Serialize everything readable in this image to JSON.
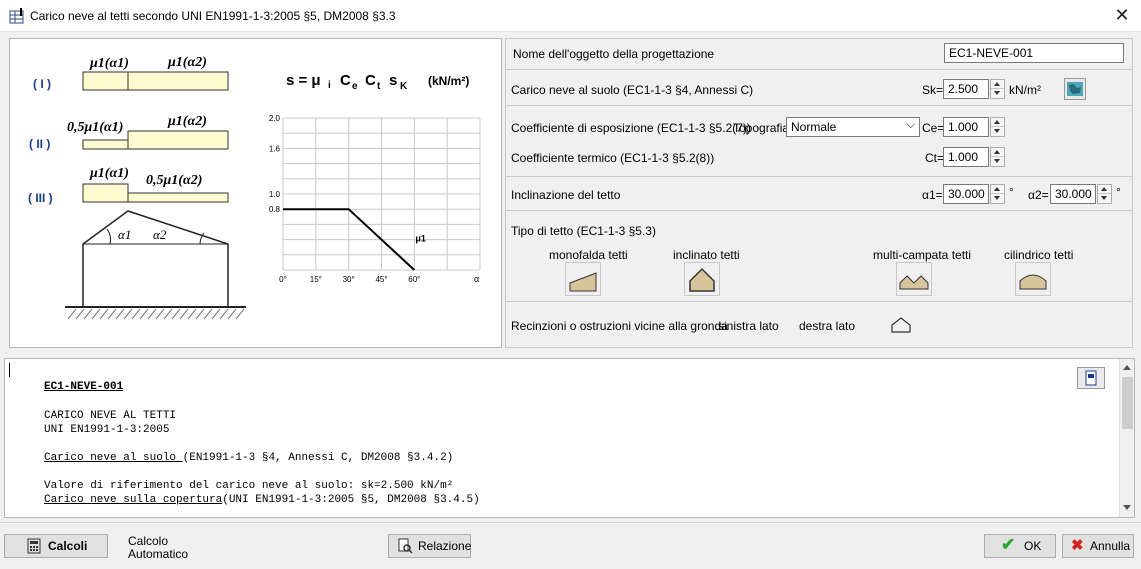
{
  "window": {
    "title": "Carico neve al tetti secondo UNI EN1991-1-3:2005 §5, DM2008 §3.3"
  },
  "diagram": {
    "formula_s": "s = μ",
    "formula_i": "i",
    "formula_ce": "C",
    "formula_ce_sub": "e",
    "formula_ct": "C",
    "formula_ct_sub": "t",
    "formula_sk": "s",
    "formula_sk_sub": "K",
    "formula_units": "(kN/m²)",
    "case_I": "( I )",
    "case_II": "( II )",
    "case_III": "( III )",
    "mu1a1": "μ1(α1)",
    "mu1a2": "μ1(α2)",
    "half_mu1a1": "0,5μ1(α1)",
    "half_mu1a2": "0,5μ1(α2)",
    "alpha1": "α1",
    "alpha2": "α2",
    "chart_mu_label": "μ1",
    "chart_alpha_label": "α"
  },
  "chart_data": {
    "type": "line",
    "x": [
      0,
      30,
      60
    ],
    "y": [
      0.8,
      0.8,
      0
    ],
    "xticks": [
      "0°",
      "15°",
      "30°",
      "45°",
      "60°"
    ],
    "yticks": [
      "2.0",
      "1.6",
      "1.0",
      "0.8"
    ],
    "xlim": [
      0,
      90
    ],
    "ylim": [
      0,
      2.0
    ],
    "xlabel": "α",
    "ylabel": ""
  },
  "form": {
    "object_name_label": "Nome dell'oggetto della progettazione",
    "object_name_value": "EC1-NEVE-001",
    "ground_snow_label": "Carico neve al suolo  (EC1-1-3 §4, Annessi C)",
    "sk_label": "Sk=",
    "sk_value": "2.500",
    "sk_unit": "kN/m²",
    "exposure_label": "Coefficiente di esposizione  (EC1-1-3 §5.2(7))",
    "topografia_label": "Topografia",
    "topografia_value": "Normale",
    "ce_label": "Ce=",
    "ce_value": "1.000",
    "thermal_label": "Coefficiente termico  (EC1-1-3 §5.2(8))",
    "ct_label": "Ct=",
    "ct_value": "1.000",
    "slope_label": "Inclinazione del tetto",
    "alpha1_label": "α1=",
    "alpha1_value": "30.000",
    "alpha2_label": "α2=",
    "alpha2_value": "30.000",
    "deg": "°",
    "roof_type_label": "Tipo di tetto  (EC1-1-3 §5.3)",
    "roof_types": [
      "monofalda tetti",
      "inclinato tetti",
      "multi-campata tetti",
      "cilindrico tetti"
    ],
    "obstructions_label": "Recinzioni o ostruzioni vicine alla gronda",
    "left_side": "sinistra lato",
    "right_side": "destra lato"
  },
  "report": {
    "line1": "EC1-NEVE-001",
    "line2": "CARICO NEVE AL TETTI",
    "line3": "UNI EN1991-1-3:2005",
    "line4a": "Carico neve al suolo ",
    "line4b": "(EN1991-1-3 §4, Annessi C, DM2008 §3.4.2)",
    "line5": "Valore di riferimento del carico neve al suolo: sk=2.500 kN/m²",
    "line6a": "Carico neve sulla copertura",
    "line6b": "(UNI EN1991-1-3:2005 §5, DM2008 §3.4.5)"
  },
  "footer": {
    "calc_button": "Calcoli",
    "auto_calc_line1": "Calcolo",
    "auto_calc_line2": "Automatico",
    "report_button": "Relazione",
    "ok_button": "OK",
    "cancel_button": "Annulla"
  }
}
